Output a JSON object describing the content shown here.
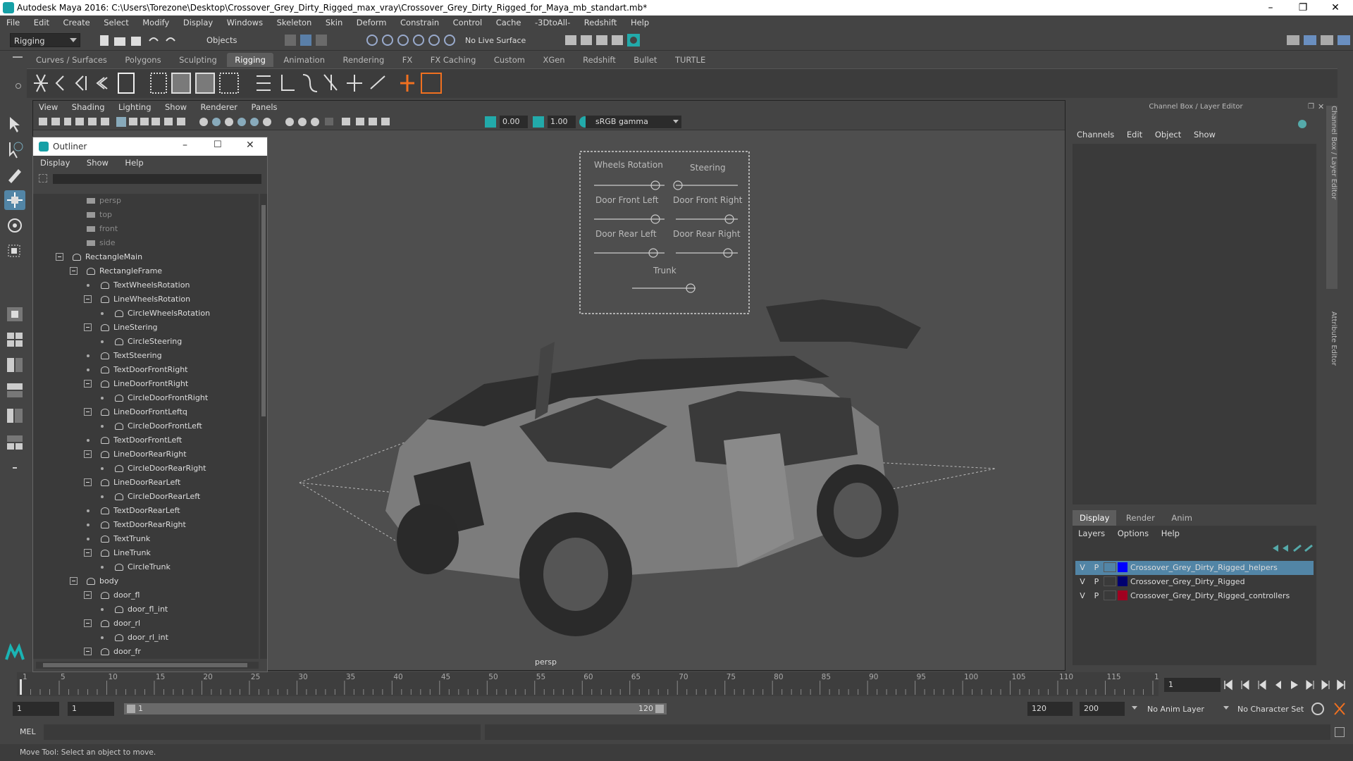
{
  "window": {
    "title": "Autodesk Maya 2016: C:\\Users\\Torezone\\Desktop\\Crossover_Grey_Dirty_Rigged_max_vray\\Crossover_Grey_Dirty_Rigged_for_Maya_mb_standart.mb*",
    "minimize": "–",
    "restore": "❐",
    "close": "✕"
  },
  "menubar": [
    "File",
    "Edit",
    "Create",
    "Select",
    "Modify",
    "Display",
    "Windows",
    "Skeleton",
    "Skin",
    "Deform",
    "Constrain",
    "Control",
    "Cache",
    "-3DtoAll-",
    "Redshift",
    "Help"
  ],
  "status": {
    "mode": "Rigging",
    "objects": "Objects",
    "live_surface": "No Live Surface"
  },
  "shelf_tabs": [
    "Curves / Surfaces",
    "Polygons",
    "Sculpting",
    "Rigging",
    "Animation",
    "Rendering",
    "FX",
    "FX Caching",
    "Custom",
    "XGen",
    "Redshift",
    "Bullet",
    "TURTLE"
  ],
  "shelf_active": "Rigging",
  "viewport": {
    "menu": [
      "View",
      "Shading",
      "Lighting",
      "Show",
      "Renderer",
      "Panels"
    ],
    "near_value": "0.00",
    "far_value": "1.00",
    "colorspace": "sRGB gamma",
    "camera_label": "persp",
    "rig_labels": {
      "wheels_rotation": "Wheels Rotation",
      "steering": "Steering",
      "door_front_left": "Door Front Left",
      "door_front_right": "Door Front Right",
      "door_rear_left": "Door Rear Left",
      "door_rear_right": "Door Rear Right",
      "trunk": "Trunk"
    }
  },
  "outliner": {
    "title": "Outliner",
    "menu": [
      "Display",
      "Show",
      "Help"
    ],
    "rows": [
      {
        "label": "persp",
        "depth": 2,
        "kind": "cam",
        "exp": false
      },
      {
        "label": "top",
        "depth": 2,
        "kind": "cam",
        "exp": false
      },
      {
        "label": "front",
        "depth": 2,
        "kind": "cam",
        "exp": false
      },
      {
        "label": "side",
        "depth": 2,
        "kind": "cam",
        "exp": false
      },
      {
        "label": "RectangleMain",
        "depth": 1,
        "kind": "node",
        "exp": true
      },
      {
        "label": "RectangleFrame",
        "depth": 2,
        "kind": "node",
        "exp": true
      },
      {
        "label": "TextWheelsRotation",
        "depth": 3,
        "kind": "node",
        "exp": false
      },
      {
        "label": "LineWheelsRotation",
        "depth": 3,
        "kind": "node",
        "exp": true
      },
      {
        "label": "CircleWheelsRotation",
        "depth": 4,
        "kind": "node",
        "exp": false
      },
      {
        "label": "LineStering",
        "depth": 3,
        "kind": "node",
        "exp": true
      },
      {
        "label": "CircleSteering",
        "depth": 4,
        "kind": "node",
        "exp": false
      },
      {
        "label": "TextSteering",
        "depth": 3,
        "kind": "node",
        "exp": false
      },
      {
        "label": "TextDoorFrontRight",
        "depth": 3,
        "kind": "node",
        "exp": false
      },
      {
        "label": "LineDoorFrontRight",
        "depth": 3,
        "kind": "node",
        "exp": true
      },
      {
        "label": "CircleDoorFrontRight",
        "depth": 4,
        "kind": "node",
        "exp": false
      },
      {
        "label": "LineDoorFrontLeftq",
        "depth": 3,
        "kind": "node",
        "exp": true
      },
      {
        "label": "CircleDoorFrontLeft",
        "depth": 4,
        "kind": "node",
        "exp": false
      },
      {
        "label": "TextDoorFrontLeft",
        "depth": 3,
        "kind": "node",
        "exp": false
      },
      {
        "label": "LineDoorRearRight",
        "depth": 3,
        "kind": "node",
        "exp": true
      },
      {
        "label": "CircleDoorRearRight",
        "depth": 4,
        "kind": "node",
        "exp": false
      },
      {
        "label": "LineDoorRearLeft",
        "depth": 3,
        "kind": "node",
        "exp": true
      },
      {
        "label": "CircleDoorRearLeft",
        "depth": 4,
        "kind": "node",
        "exp": false
      },
      {
        "label": "TextDoorRearLeft",
        "depth": 3,
        "kind": "node",
        "exp": false
      },
      {
        "label": "TextDoorRearRight",
        "depth": 3,
        "kind": "node",
        "exp": false
      },
      {
        "label": "TextTrunk",
        "depth": 3,
        "kind": "node",
        "exp": false
      },
      {
        "label": "LineTrunk",
        "depth": 3,
        "kind": "node",
        "exp": true
      },
      {
        "label": "CircleTrunk",
        "depth": 4,
        "kind": "node",
        "exp": false
      },
      {
        "label": "body",
        "depth": 2,
        "kind": "node",
        "exp": true
      },
      {
        "label": "door_fl",
        "depth": 3,
        "kind": "node",
        "exp": true
      },
      {
        "label": "door_fl_int",
        "depth": 4,
        "kind": "node",
        "exp": false
      },
      {
        "label": "door_rl",
        "depth": 3,
        "kind": "node",
        "exp": true
      },
      {
        "label": "door_rl_int",
        "depth": 4,
        "kind": "node",
        "exp": false
      },
      {
        "label": "door_fr",
        "depth": 3,
        "kind": "node",
        "exp": true
      }
    ]
  },
  "channel_box": {
    "title": "Channel Box / Layer Editor",
    "menu": [
      "Channels",
      "Edit",
      "Object",
      "Show"
    ],
    "side_tabs": [
      "Channel Box / Layer Editor",
      "Attribute Editor"
    ]
  },
  "layer_editor": {
    "tabs": [
      "Display",
      "Render",
      "Anim"
    ],
    "active_tab": "Display",
    "menu": [
      "Layers",
      "Options",
      "Help"
    ],
    "layers": [
      {
        "v": "V",
        "p": "P",
        "color": "#0000ff",
        "name": "Crossover_Grey_Dirty_Rigged_helpers",
        "selected": true
      },
      {
        "v": "V",
        "p": "P",
        "color": "#000070",
        "name": "Crossover_Grey_Dirty_Rigged",
        "selected": false
      },
      {
        "v": "V",
        "p": "P",
        "color": "#a00020",
        "name": "Crossover_Grey_Dirty_Rigged_controllers",
        "selected": false
      }
    ]
  },
  "timeline": {
    "tick_labels": [
      "1",
      "5",
      "10",
      "15",
      "20",
      "25",
      "30",
      "35",
      "40",
      "45",
      "50",
      "55",
      "60",
      "65",
      "70",
      "75",
      "80",
      "85",
      "90",
      "95",
      "100",
      "105",
      "110",
      "115",
      "120"
    ],
    "current_frame": "1",
    "range_start": "1",
    "range_start2": "1",
    "range_slider_start": "1",
    "range_slider_end": "120",
    "range_end": "120",
    "anim_end": "200",
    "anim_layer": "No Anim Layer",
    "character_set": "No Character Set"
  },
  "command_line": {
    "lang": "MEL"
  },
  "help_line": "Move Tool: Select an object to move."
}
